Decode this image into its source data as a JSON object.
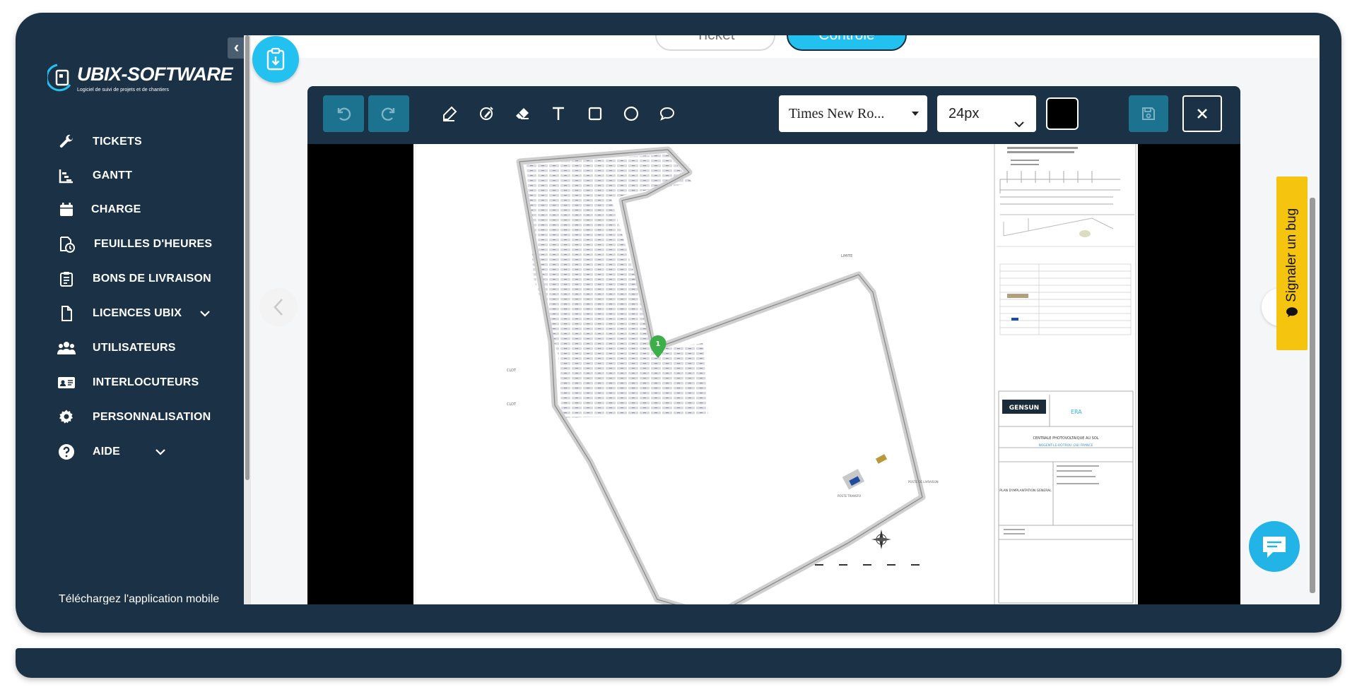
{
  "brand": {
    "name": "UBIX-SOFTWARE",
    "tagline": "Logiciel de suivi de projets et de chantiers"
  },
  "sidebar": {
    "collapse_icon": "chevron-left-icon",
    "items": [
      {
        "label": "TICKETS",
        "icon": "wrench-icon"
      },
      {
        "label": "GANTT",
        "icon": "gantt-chart-icon"
      },
      {
        "label": "CHARGE",
        "icon": "calendar-icon"
      },
      {
        "label": "FEUILLES D'HEURES",
        "icon": "timesheet-clock-icon"
      },
      {
        "label": "BONS DE LIVRAISON",
        "icon": "clipboard-list-icon"
      },
      {
        "label": "LICENCES UBIX",
        "icon": "document-icon",
        "expandable": true
      },
      {
        "label": "UTILISATEURS",
        "icon": "users-icon"
      },
      {
        "label": "INTERLOCUTEURS",
        "icon": "contact-card-icon"
      },
      {
        "label": "PERSONNALISATION",
        "icon": "gear-icon"
      },
      {
        "label": "AIDE",
        "icon": "help-circle-icon",
        "expandable": true
      }
    ],
    "mobile_app_text": "Téléchargez l'application mobile"
  },
  "mode_tabs": {
    "ticket": "Ticket",
    "controle": "Contrôle"
  },
  "editor": {
    "undo_icon": "undo-icon",
    "redo_icon": "redo-icon",
    "tools": [
      "pen-icon",
      "highlighter-icon",
      "eraser-icon",
      "text-icon",
      "rectangle-icon",
      "circle-icon",
      "speech-bubble-icon"
    ],
    "font_family": "Times New Ro...",
    "font_size": "24px",
    "stroke_color": "#000000",
    "save_icon": "save-icon",
    "close_icon": "close-icon"
  },
  "plan": {
    "marker_label": "1",
    "company_logo": "GENSUN",
    "title_block": "CENTRALE PHOTOVOLTAIQUE AU SOL",
    "subtitle": "NOGENT-LE-ROTROU (28) FRANCE",
    "drawing_name": "PLAN D'IMPLANTATION GENERAL"
  },
  "bug_report": "Signaler un bug",
  "colors": {
    "frame": "#1b3246",
    "accent": "#22c1ef",
    "toolbar_button": "#1c738f",
    "bug_tab": "#f5c40f",
    "marker": "#3cae4a"
  }
}
